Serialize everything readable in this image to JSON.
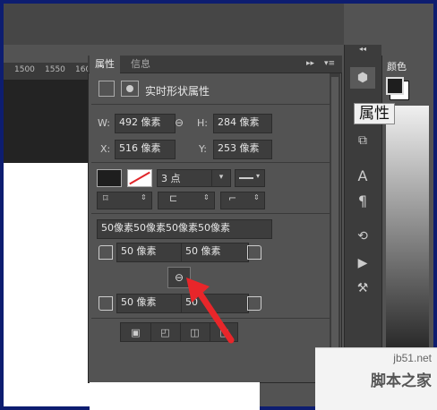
{
  "ruler": {
    "marks": [
      "1500",
      "1550",
      "1600"
    ]
  },
  "panel": {
    "tabs": [
      {
        "label": "属性"
      },
      {
        "label": "信息"
      }
    ],
    "header_title": "实时形状属性",
    "w_label": "W:",
    "w_value": "492 像素",
    "h_label": "H:",
    "h_value": "284 像素",
    "x_label": "X:",
    "x_value": "516 像素",
    "y_label": "Y:",
    "y_value": "253 像素",
    "stroke_width": "3 点",
    "corner_summary": "50像素50像素50像素50像素",
    "corner_tl": "50 像素",
    "corner_tr": "50 像素",
    "corner_bl": "50 像素",
    "corner_br": "50"
  },
  "right_dock": {
    "tooltip": "属性"
  },
  "far_right": {
    "tab_label": "颜色"
  },
  "watermark": {
    "line1": "jb51.net",
    "line2": "脚本之家"
  },
  "colors": {
    "panel_bg": "#535353",
    "field_bg": "#3d3d3d",
    "accent_arrow": "#e8262a"
  }
}
